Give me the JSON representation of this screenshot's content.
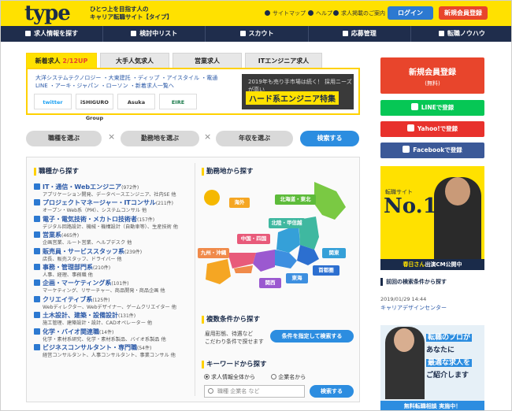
{
  "header": {
    "logo": "type",
    "tagline_1": "ひとつ上を目指す人の",
    "tagline_2": "キャリア転職サイト【タイプ】",
    "links": [
      "サイトマップ",
      "ヘルプ",
      "求人掲載のご案内"
    ],
    "login_label": "ログイン",
    "register_label": "新規会員登録"
  },
  "nav": {
    "items": [
      "求人情報を探す",
      "検討中リスト",
      "スカウト",
      "応募管理",
      "転職ノウハウ"
    ]
  },
  "tabs": {
    "items": [
      {
        "label": "新着求人",
        "count": "2/12UP"
      },
      {
        "label": "大手人気求人"
      },
      {
        "label": "営業求人"
      },
      {
        "label": "ITエンジニア求人"
      }
    ],
    "links_line1": "大洋システムテクノロジー ・大東建託 ・ディップ ・アイスタイル ・電通",
    "links_line2": "LINE ・アーキ・ジャパン ・ローソン ・新着求人一覧へ",
    "company_logos": [
      "twitter",
      "iSHIGURO Group",
      "Asuka",
      "EIRE"
    ],
    "banner_sub": "2019年も売り手市場は続く！ 採用ニーズが高い",
    "banner_main": "ハード系エンジニア特集"
  },
  "search": {
    "occupation_label": "職種を選ぶ",
    "location_label": "勤務地を選ぶ",
    "income_label": "年収を選ぶ",
    "submit_label": "検索する"
  },
  "occupation": {
    "title": "職種から探す",
    "items": [
      {
        "name": "IT・通信・Webエンジニア",
        "count": "(972件)",
        "sub": "アプリケーション開発、データベースエンジニア、社内SE 他"
      },
      {
        "name": "プロジェクトマネージャー・ITコンサル",
        "count": "(211件)",
        "sub": "オープン・Web系（PM）、システムコンサル 他"
      },
      {
        "name": "電子・電気技術・メカトロ技術者",
        "count": "(157件)",
        "sub": "デジタル回路設計、機械・機構設計（自動車等）、生産技術 他"
      },
      {
        "name": "営業系",
        "count": "(465件)",
        "sub": "企画営業、ルート営業、ヘルプデスク 他"
      },
      {
        "name": "販売員・サービススタッフ系",
        "count": "(239件)",
        "sub": "店長、販売スタッフ、ドライバー 他"
      },
      {
        "name": "事務・管理部門系",
        "count": "(210件)",
        "sub": "人事、経理、事務職 他"
      },
      {
        "name": "企画・マーケティング系",
        "count": "(101件)",
        "sub": "マーケティング、リサーチャー、商品開発・商品企画 他"
      },
      {
        "name": "クリエイティブ系",
        "count": "(125件)",
        "sub": "Webディレクター、Webデザイナー、ゲームクリエイター 他"
      },
      {
        "name": "土木設計、建築・設備設計",
        "count": "(131件)",
        "sub": "施工管理、建築設計・設計、CADオペレーター 他"
      },
      {
        "name": "化学・バイオ関連職",
        "count": "(14件)",
        "sub": "化学・素材系研究、化学・素材系製品、バイオ系製品 他"
      },
      {
        "name": "ビジネスコンサルタント・専門職",
        "count": "(54件)",
        "sub": "経営コンサルタント、人事コンサルタント、事業コンサル 他"
      }
    ]
  },
  "location": {
    "title": "勤務地から探す",
    "regions": [
      "海外",
      "北海道・東北",
      "北陸・甲信越",
      "中国・四国",
      "九州・沖縄",
      "関東",
      "首都圏",
      "東海",
      "関西"
    ]
  },
  "multi": {
    "title": "複数条件から探す",
    "desc_1": "雇用形態、待遇など",
    "desc_2": "こだわり条件で探せます",
    "button_label": "条件を指定して検索する"
  },
  "keyword": {
    "title": "キーワードから探す",
    "radio_all": "求人情報全体から",
    "radio_company": "企業名から",
    "placeholder": "職種 企業名 など",
    "button_label": "検索する"
  },
  "sidebar": {
    "register_title": "新規会員登録",
    "register_sub": "(無料)",
    "line_label": "LINEで登録",
    "yahoo_label": "Yahoo!で登録",
    "facebook_label": "Facebookで登録",
    "ad1_small": "転職サイト",
    "ad1_big": "No.1",
    "ad1_bar_name": "春日さん",
    "ad1_bar_text": "出演CM公開中",
    "prev_title": "前回の検索条件から探す",
    "prev_date": "2019/01/29 14:44",
    "prev_link": "キャリアデザインセンター",
    "ad2_line1": "転職のプロが",
    "ad2_line2": "あなたに",
    "ad2_line3": "最適な求人を",
    "ad2_line4": "ご紹介します",
    "ad2_bottom": "無料転職相談 実施中！"
  },
  "colors": {
    "brand_yellow": "#ffe100",
    "navy": "#1f2d4c",
    "accent_red": "#e8452c",
    "accent_blue": "#2c8de0",
    "line_green": "#06c755",
    "yahoo_red": "#e8312c",
    "facebook_blue": "#3b5998"
  }
}
